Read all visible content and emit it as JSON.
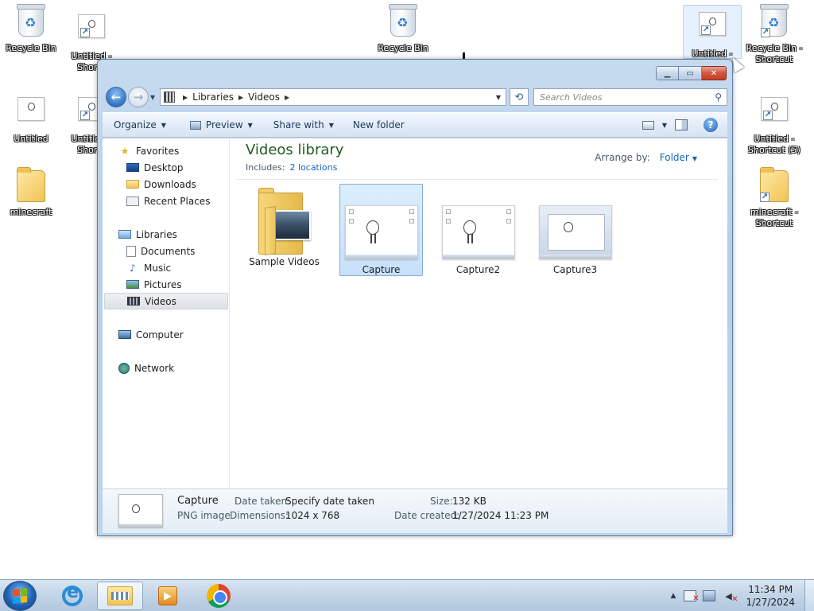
{
  "desktop": {
    "icons": [
      {
        "label": "Recycle Bin",
        "kind": "bin"
      },
      {
        "label": "Untitled - Shortcut",
        "kind": "shortcut"
      },
      {
        "label": "Recycle Bin",
        "kind": "bin"
      },
      {
        "label": "Untitled - Shortcut",
        "kind": "shortcut"
      },
      {
        "label": "Recycle Bin - Shortcut",
        "kind": "bin-shortcut"
      },
      {
        "label": "Untitled",
        "kind": "doc"
      },
      {
        "label": "Untitled - Shortcut",
        "kind": "shortcut"
      },
      {
        "label": "Untitled - Shortcut (5)",
        "kind": "shortcut"
      },
      {
        "label": "minecraft",
        "kind": "folder"
      },
      {
        "label": "minecraft - Shortcut",
        "kind": "folder-shortcut"
      }
    ],
    "icon_labels_visible": {
      "rb1": "Recycle Bin",
      "untitled_short1_a": "Untitled -",
      "untitled_short1_b": "Shortc",
      "rb2": "Recycle Bin",
      "untitled_short2_a": "Untitled -",
      "rbshort_a": "Recycle Bin -",
      "rbshort_b": "Shortcut",
      "untitled": "Untitled",
      "untitled_short3_a": "Untitled -",
      "untitled_short3_b": "Shortc",
      "untitled_short5_a": "Untitled -",
      "untitled_short5_b": "Shortcut (5)",
      "minecraft": "minecraft",
      "minecraft_short_a": "minecraft -",
      "minecraft_short_b": "Shortcut"
    }
  },
  "window": {
    "address": {
      "crumbs": [
        "Libraries",
        "Videos"
      ]
    },
    "search": {
      "placeholder": "Search Videos"
    },
    "toolbar": {
      "organize": "Organize",
      "preview": "Preview",
      "share_with": "Share with",
      "new_folder": "New folder"
    },
    "nav": {
      "favorites": "Favorites",
      "desktop": "Desktop",
      "downloads": "Downloads",
      "recent_places": "Recent Places",
      "libraries": "Libraries",
      "documents": "Documents",
      "music": "Music",
      "pictures": "Pictures",
      "videos": "Videos",
      "computer": "Computer",
      "network": "Network"
    },
    "library": {
      "title": "Videos library",
      "includes_label": "Includes:",
      "includes_link": "2 locations",
      "arrange_label": "Arrange by:",
      "arrange_value": "Folder"
    },
    "files": [
      {
        "name": "Sample Videos",
        "kind": "folder",
        "selected": false
      },
      {
        "name": "Capture",
        "kind": "image",
        "selected": true
      },
      {
        "name": "Capture2",
        "kind": "image",
        "selected": false
      },
      {
        "name": "Capture3",
        "kind": "image",
        "selected": false
      }
    ],
    "details": {
      "name": "Capture",
      "type": "PNG image",
      "date_taken_label": "Date taken:",
      "date_taken_value": "Specify date taken",
      "dimensions_label": "Dimensions:",
      "dimensions_value": "1024 x 768",
      "size_label": "Size:",
      "size_value": "132 KB",
      "date_created_label": "Date created:",
      "date_created_value": "1/27/2024 11:23 PM"
    }
  },
  "taskbar": {
    "time": "11:34 PM",
    "date": "1/27/2024"
  }
}
